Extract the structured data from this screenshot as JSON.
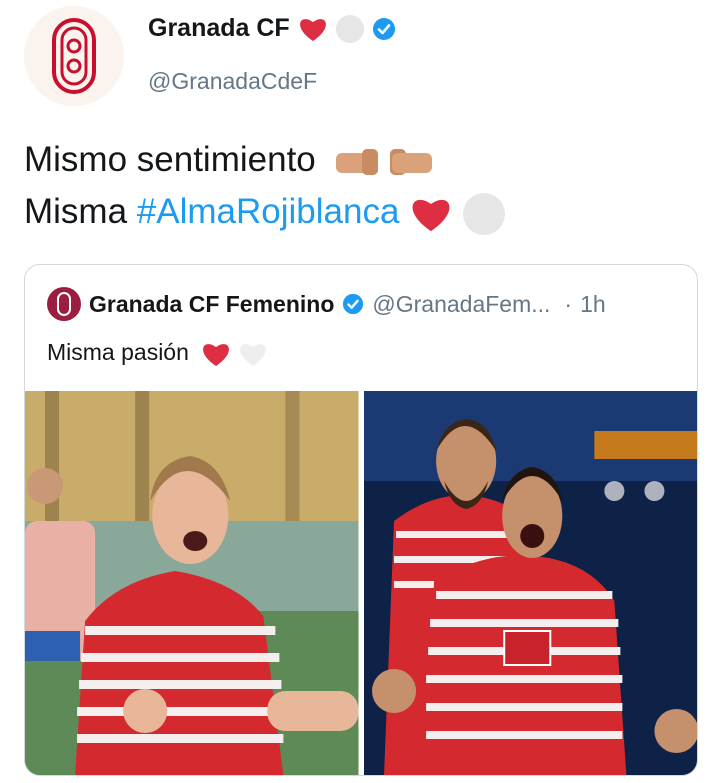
{
  "tweet": {
    "display_name": "Granada CF",
    "handle": "@GranadaCdeF",
    "line1": "Mismo sentimiento",
    "line2_prefix": "Misma ",
    "hashtag": "#AlmaRojiblanca",
    "icons": [
      "red-heart-icon",
      "white-heart-icon",
      "verified-badge-icon",
      "fist-bump-icon"
    ]
  },
  "quoted": {
    "display_name": "Granada CF Femenino",
    "handle": "@GranadaFem...",
    "time_sep": "·",
    "time": "1h",
    "text": "Misma pasión"
  },
  "photos": [
    "photo-woman-player-celebrating",
    "photo-men-players-celebrating"
  ],
  "colors": {
    "link": "#1d9bf0",
    "muted": "#657786",
    "heart_red": "#dd2e44",
    "kit_red": "#d42a2f"
  }
}
